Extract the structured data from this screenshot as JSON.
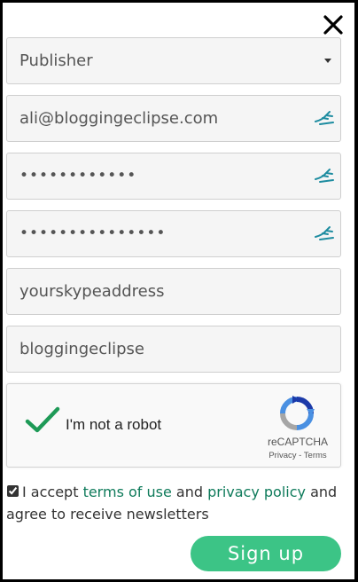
{
  "form": {
    "account_type": {
      "selected": "Publisher"
    },
    "email": "ali@bloggingeclipse.com",
    "password": "••••••••••••",
    "confirm_password": "•••••••••••••••",
    "skype": "yourskypeaddress",
    "website": "bloggingeclipse"
  },
  "captcha": {
    "label": "I'm not a robot",
    "brand": "reCAPTCHA",
    "privacy": "Privacy",
    "separator": " - ",
    "terms": "Terms"
  },
  "consent": {
    "prefix": "I accept ",
    "terms_link": "terms of use",
    "and": " and ",
    "privacy_link": "privacy policy",
    "suffix": " and agree to receive newsletters"
  },
  "signup_label": "Sign up",
  "icons": {
    "close": "close-icon",
    "caret": "caret-down-icon",
    "password_manager": "password-manager-key-icon",
    "check": "checkmark-icon",
    "recaptcha": "recaptcha-logo-icon"
  },
  "colors": {
    "accent": "#3cc486",
    "link": "#0f7b5b",
    "key_icon": "#1d8ca0"
  }
}
